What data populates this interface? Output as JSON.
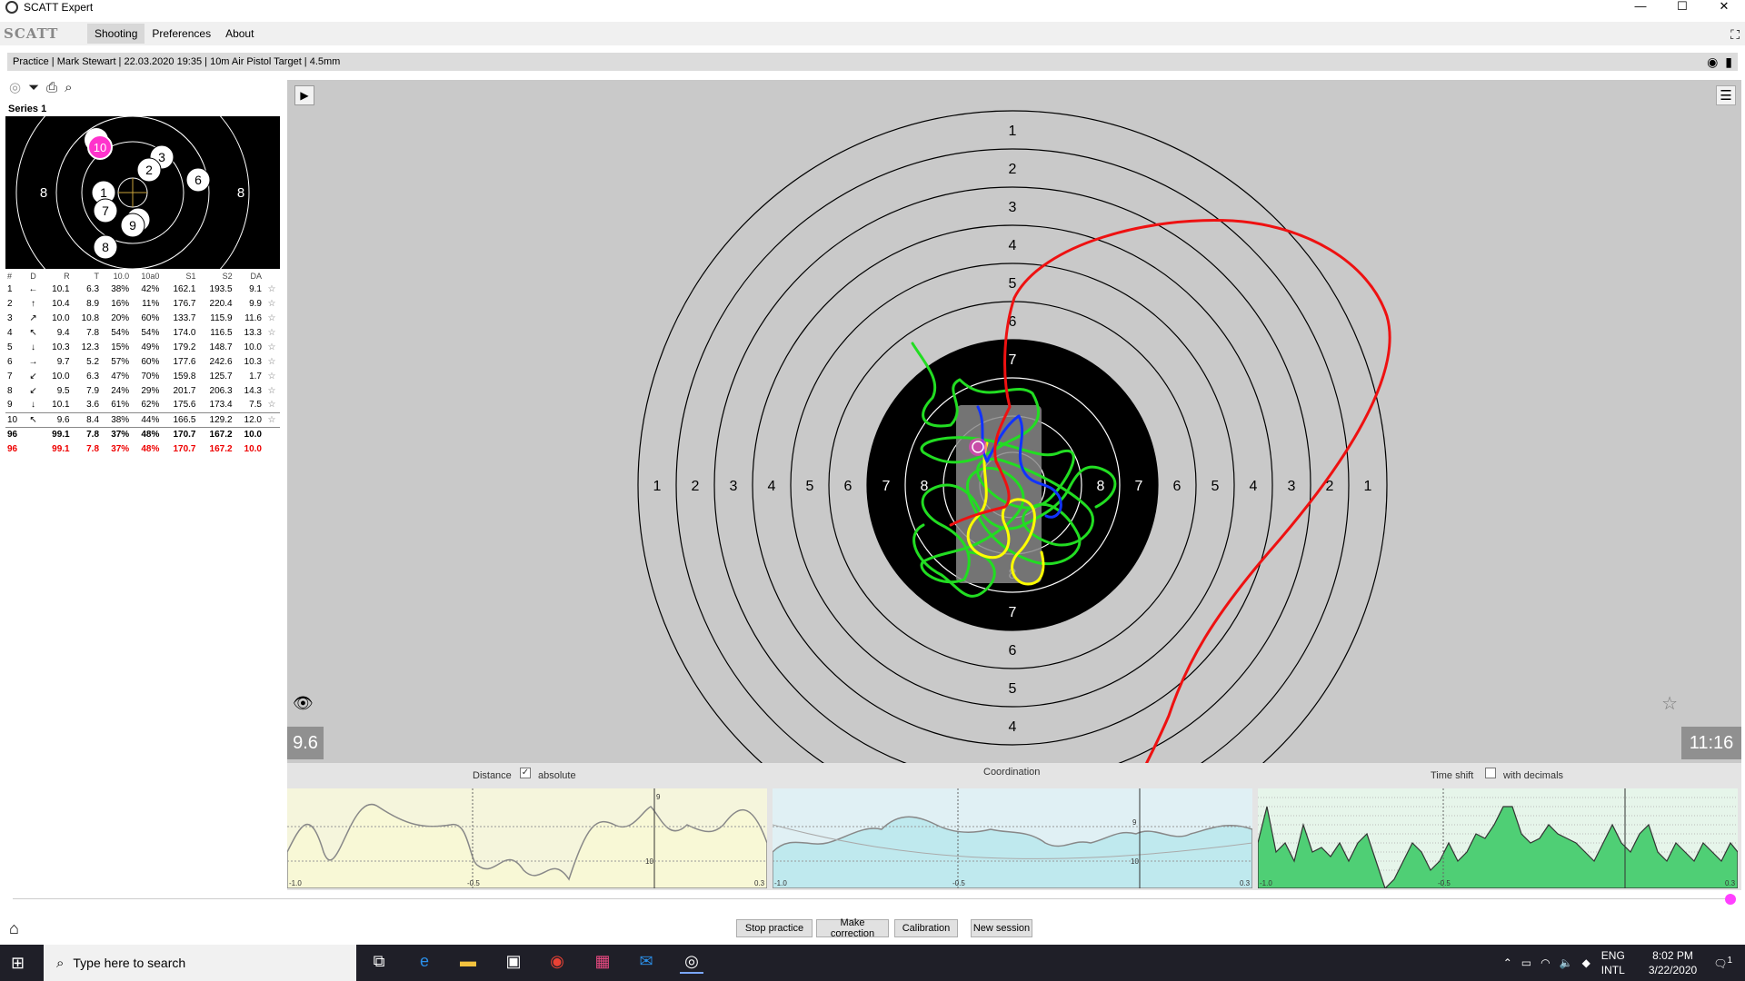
{
  "window": {
    "title": "SCATT Expert",
    "controls": [
      "—",
      "☐",
      "✕"
    ]
  },
  "menu": {
    "logo": "SCATT",
    "items": [
      "Shooting",
      "Preferences",
      "About"
    ],
    "active": "Shooting"
  },
  "info": {
    "text": "Practice | Mark Stewart | 22.03.2020 19:35 | 10m Air Pistol Target | 4.5mm"
  },
  "series": {
    "title": "Series 1",
    "columns": [
      "#",
      "D",
      "R",
      "T",
      "10.0",
      "10a0",
      "S1",
      "S2",
      "DA"
    ],
    "rows": [
      {
        "n": "1",
        "d": "←",
        "r": "10.1",
        "t": "6.3",
        "c10": "38%",
        "c10a0": "42%",
        "s1": "162.1",
        "s2": "193.5",
        "da": "9.1"
      },
      {
        "n": "2",
        "d": "↑",
        "r": "10.4",
        "t": "8.9",
        "c10": "16%",
        "c10a0": "11%",
        "s1": "176.7",
        "s2": "220.4",
        "da": "9.9"
      },
      {
        "n": "3",
        "d": "↗",
        "r": "10.0",
        "t": "10.8",
        "c10": "20%",
        "c10a0": "60%",
        "s1": "133.7",
        "s2": "115.9",
        "da": "11.6"
      },
      {
        "n": "4",
        "d": "↖",
        "r": "9.4",
        "t": "7.8",
        "c10": "54%",
        "c10a0": "54%",
        "s1": "174.0",
        "s2": "116.5",
        "da": "13.3"
      },
      {
        "n": "5",
        "d": "↓",
        "r": "10.3",
        "t": "12.3",
        "c10": "15%",
        "c10a0": "49%",
        "s1": "179.2",
        "s2": "148.7",
        "da": "10.0"
      },
      {
        "n": "6",
        "d": "→",
        "r": "9.7",
        "t": "5.2",
        "c10": "57%",
        "c10a0": "60%",
        "s1": "177.6",
        "s2": "242.6",
        "da": "10.3"
      },
      {
        "n": "7",
        "d": "↙",
        "r": "10.0",
        "t": "6.3",
        "c10": "47%",
        "c10a0": "70%",
        "s1": "159.8",
        "s2": "125.7",
        "da": "1.7"
      },
      {
        "n": "8",
        "d": "↙",
        "r": "9.5",
        "t": "7.9",
        "c10": "24%",
        "c10a0": "29%",
        "s1": "201.7",
        "s2": "206.3",
        "da": "14.3"
      },
      {
        "n": "9",
        "d": "↓",
        "r": "10.1",
        "t": "3.6",
        "c10": "61%",
        "c10a0": "62%",
        "s1": "175.6",
        "s2": "173.4",
        "da": "7.5"
      },
      {
        "n": "10",
        "d": "↖",
        "r": "9.6",
        "t": "8.4",
        "c10": "38%",
        "c10a0": "44%",
        "s1": "166.5",
        "s2": "129.2",
        "da": "12.0"
      }
    ],
    "selected_row": "10",
    "total": {
      "n": "96",
      "r": "99.1",
      "t": "7.8",
      "c10": "37%",
      "c10a0": "48%",
      "s1": "170.7",
      "s2": "167.2",
      "da": "10.0"
    },
    "total_red": {
      "n": "96",
      "r": "99.1",
      "t": "7.8",
      "c10": "37%",
      "c10a0": "48%",
      "s1": "170.7",
      "s2": "167.2",
      "da": "10.0"
    },
    "mini_target_labels": [
      "8",
      "8"
    ],
    "mini_shots": [
      "10",
      "3",
      "2",
      "6",
      "1",
      "7",
      "9",
      "8",
      "5"
    ]
  },
  "target": {
    "ring_labels": [
      "1",
      "2",
      "3",
      "4",
      "5",
      "6",
      "7",
      "8"
    ],
    "score": "9.6",
    "time": "11:16"
  },
  "graphs": {
    "distance_label": "Distance",
    "absolute_label": "absolute",
    "coordination_label": "Coordination",
    "timeshift_label": "Time shift",
    "decimals_label": "with decimals",
    "axis_left": "-1.0",
    "axis_mid": "-0.5",
    "axis_right": "0.3",
    "tick_9": "9",
    "tick_10": "10"
  },
  "buttons": {
    "stop": "Stop practice",
    "correction": "Make correction",
    "calibration": "Calibration",
    "new_session": "New session"
  },
  "taskbar": {
    "search_placeholder": "Type here to search",
    "lang1": "ENG",
    "lang2": "INTL",
    "time": "8:02 PM",
    "date": "3/22/2020",
    "notif_count": "1"
  },
  "colors": {
    "shot_highlight": "#ff33cc",
    "trace_green": "#22dd22",
    "trace_yellow": "#ffff00",
    "trace_blue": "#1133ff",
    "trace_red": "#ee1111"
  }
}
